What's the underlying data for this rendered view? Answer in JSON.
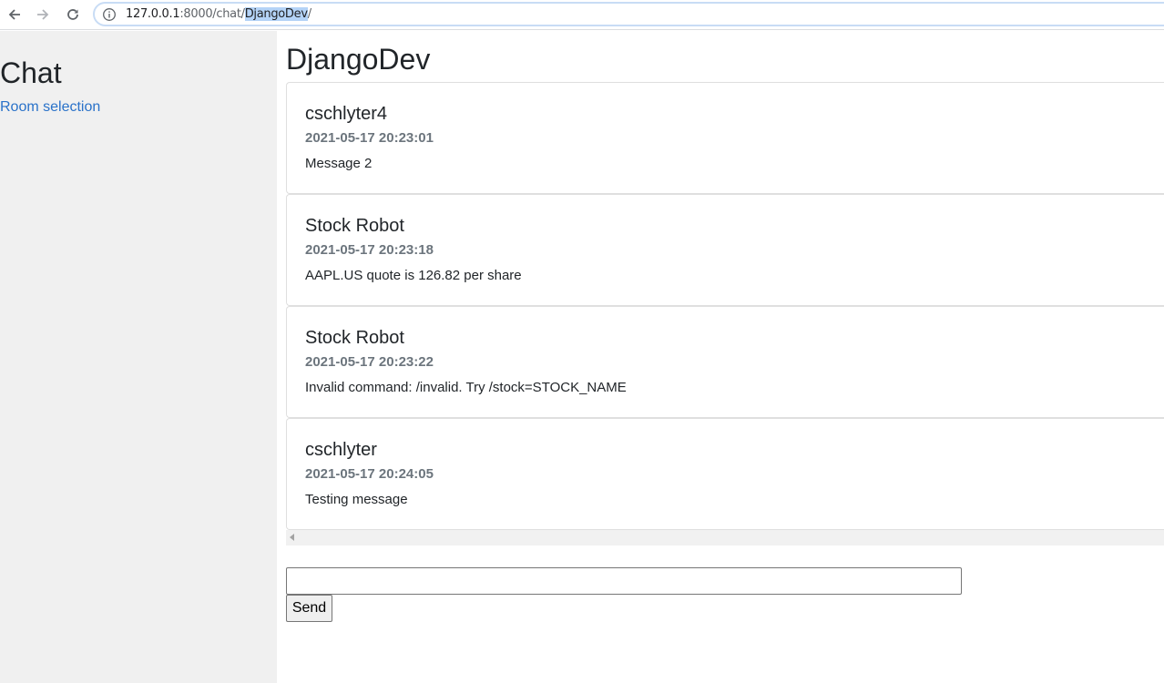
{
  "browser": {
    "url_host": "127.0.0.1",
    "url_rest_dim": ":8000/chat/",
    "url_selected": "DjangoDev",
    "url_tail": "/"
  },
  "sidebar": {
    "title": "Chat",
    "room_link": "Room selection"
  },
  "main": {
    "room_title": "DjangoDev",
    "messages": [
      {
        "author": "cschlyter4",
        "time": "2021-05-17 20:23:01",
        "text": "Message 2"
      },
      {
        "author": "Stock Robot",
        "time": "2021-05-17 20:23:18",
        "text": "AAPL.US quote is 126.82 per share"
      },
      {
        "author": "Stock Robot",
        "time": "2021-05-17 20:23:22",
        "text": "Invalid command: /invalid. Try /stock=STOCK_NAME"
      },
      {
        "author": "cschlyter",
        "time": "2021-05-17 20:24:05",
        "text": "Testing message"
      }
    ],
    "input_value": "",
    "send_label": "Send"
  },
  "colors": {
    "sidebar_bg": "#f0f0f0",
    "link": "#2a72c9",
    "timestamp": "#6c757d"
  }
}
